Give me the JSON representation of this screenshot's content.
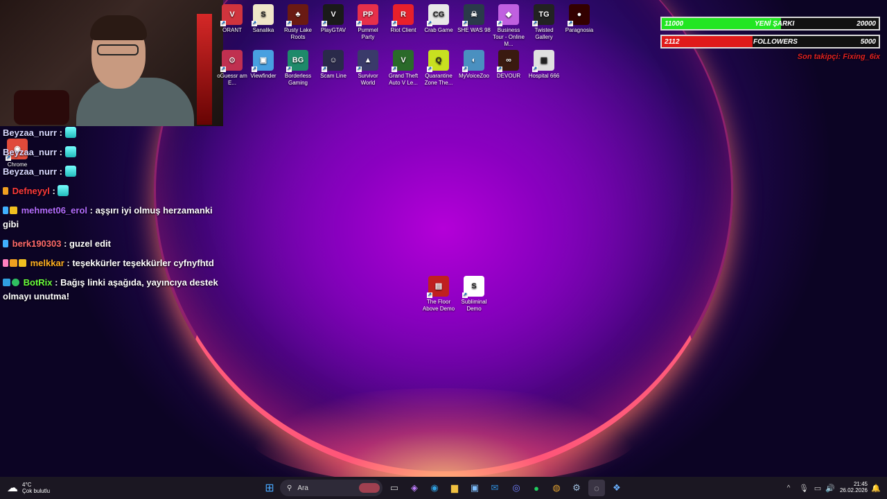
{
  "desktop_icons": [
    {
      "label": "ORANT",
      "color": "#d1343d",
      "glyph": "V"
    },
    {
      "label": "Sanalika",
      "color": "#f0e6c8",
      "glyph": "S"
    },
    {
      "label": "Rusty Lake Roots",
      "color": "#6a1a12",
      "glyph": "♣"
    },
    {
      "label": "PlayGTAV",
      "color": "#1a1a1a",
      "glyph": "V"
    },
    {
      "label": "Pummel Party",
      "color": "#e6304a",
      "glyph": "PP"
    },
    {
      "label": "Riot Client",
      "color": "#e8202a",
      "glyph": "R"
    },
    {
      "label": "Crab Game",
      "color": "#e8e8e8",
      "glyph": "CG"
    },
    {
      "label": "SHE WAS 98",
      "color": "#2a3a4a",
      "glyph": "☠"
    },
    {
      "label": "Business Tour - Online M...",
      "color": "#c060e0",
      "glyph": "◆"
    },
    {
      "label": "Twisted Gallery",
      "color": "#222",
      "glyph": "TG"
    },
    {
      "label": "Paragnosia",
      "color": "#300",
      "glyph": "●"
    },
    {
      "label": "oGuessr am E...",
      "color": "#c03050",
      "glyph": "⊙"
    },
    {
      "label": "Viewfinder",
      "color": "#48a0e0",
      "glyph": "▣"
    },
    {
      "label": "Borderless Gaming",
      "color": "#1e8a6a",
      "glyph": "BG"
    },
    {
      "label": "Scam Line",
      "color": "#2a2a4a",
      "glyph": "☺"
    },
    {
      "label": "Survivor World",
      "color": "#3a3a6a",
      "glyph": "▲"
    },
    {
      "label": "Grand Theft Auto V Le...",
      "color": "#2a6a2a",
      "glyph": "V"
    },
    {
      "label": "Quarantine Zone The...",
      "color": "#c8e020",
      "glyph": "Q"
    },
    {
      "label": "MyVoiceZoo",
      "color": "#4a90c0",
      "glyph": "◐"
    },
    {
      "label": "DEVOUR",
      "color": "#3a1a10",
      "glyph": "∞"
    },
    {
      "label": "Hospital 666",
      "color": "#e0e0e0",
      "glyph": "▦"
    },
    {
      "label": "Chrome",
      "color": "#e04a3a",
      "glyph": "◉"
    },
    {
      "label": "The Floor Above Demo",
      "color": "#c02020",
      "glyph": "▤"
    },
    {
      "label": "Subliminal Demo",
      "color": "#ffffff",
      "glyph": "S"
    }
  ],
  "chat": [
    {
      "user": "Beyzaa_nurr",
      "color": "#d8d8ff",
      "text": " : "
    },
    {
      "user": "Beyzaa_nurr",
      "color": "#d8d8ff",
      "text": " : "
    },
    {
      "user": "Beyzaa_nurr",
      "color": "#d8d8ff",
      "text": " : "
    },
    {
      "user": "Defneyyl",
      "color": "#ff3a3a",
      "text": " : "
    },
    {
      "user": "mehmet06_erol",
      "color": "#b46cff",
      "text": " : aşşırı iyi olmuş herzamanki gibi"
    },
    {
      "user": "berk190303",
      "color": "#ff6a6a",
      "text": " : guzel edit"
    },
    {
      "user": "melkkar",
      "color": "#ffb020",
      "text": " : teşekkürler teşekkürler cyfnyfhtd"
    },
    {
      "user": "BotRix",
      "color": "#6aff3a",
      "text": " : Bağış linki aşağıda, yayıncıya destek olmayı unutma!"
    }
  ],
  "bars": {
    "song": {
      "current": "11000",
      "label": "YENİ ŞARKI",
      "goal": "20000",
      "progress": 0.55
    },
    "followers": {
      "current": "2112",
      "label": "FOLLOWERS",
      "goal": "5000",
      "progress": 0.42
    },
    "last_follower": "Son takipçi: Fixing_6ix"
  },
  "taskbar": {
    "weather_temp": "4°C",
    "weather_desc": "Çok bulutlu",
    "search_placeholder": "Ara",
    "time": "21:45",
    "date": "26.02.2026"
  }
}
